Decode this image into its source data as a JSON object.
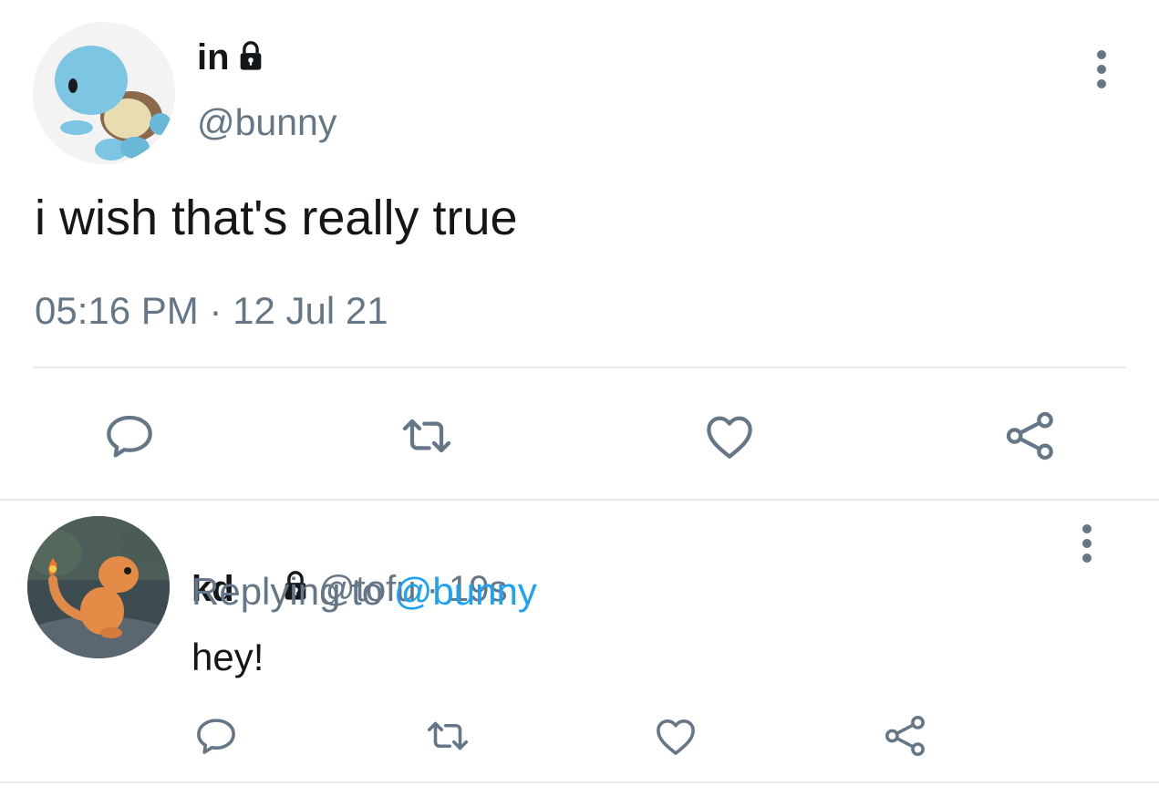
{
  "main_tweet": {
    "display_name": "in",
    "handle": "@bunny",
    "text": "i wish that's really true",
    "time": "05:16 PM",
    "separator": " · ",
    "date": "12 Jul 21",
    "avatar": "squirtle-avatar",
    "protected_icon": "lock-icon"
  },
  "reply": {
    "display_name": "kd",
    "handle": "@tofu",
    "separator": " · ",
    "age": "19s",
    "replying_to_label": "Replying to ",
    "replying_to_handle": "@bunny",
    "text": "hey!",
    "avatar": "charmander-avatar",
    "protected_icon": "lock-icon"
  },
  "actions": [
    "reply-icon",
    "retweet-icon",
    "like-icon",
    "share-icon"
  ],
  "colors": {
    "text": "#14171a",
    "secondary": "#657786",
    "link": "#1da1f2",
    "divider": "#e6ecf0",
    "icon": "#657786"
  }
}
